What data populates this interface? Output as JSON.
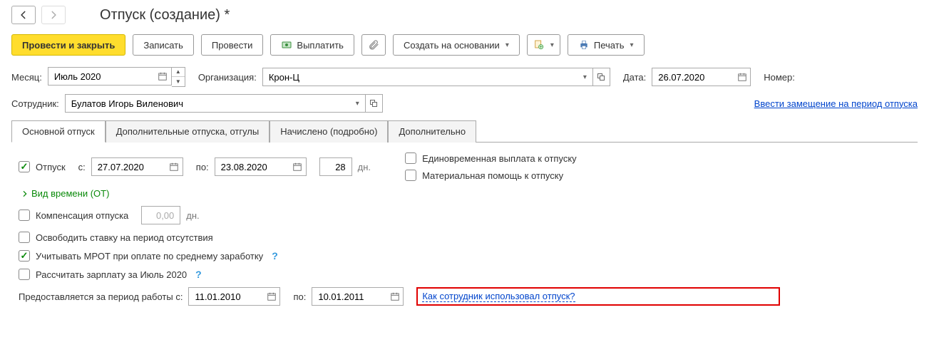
{
  "nav": {
    "back": "←",
    "forward": "→"
  },
  "title": "Отпуск (создание) *",
  "toolbar": {
    "post_close": "Провести и закрыть",
    "save": "Записать",
    "post": "Провести",
    "pay": "Выплатить",
    "create_based": "Создать на основании",
    "print": "Печать"
  },
  "row1": {
    "month_label": "Месяц:",
    "month_value": "Июль 2020",
    "org_label": "Организация:",
    "org_value": "Крон-Ц",
    "date_label": "Дата:",
    "date_value": "26.07.2020",
    "number_label": "Номер:"
  },
  "row2": {
    "emp_label": "Сотрудник:",
    "emp_value": "Булатов Игорь Виленович",
    "subst_link": "Ввести замещение на период отпуска"
  },
  "tabs": {
    "t1": "Основной отпуск",
    "t2": "Дополнительные отпуска, отгулы",
    "t3": "Начислено (подробно)",
    "t4": "Дополнительно"
  },
  "main": {
    "vac_label": "Отпуск",
    "from_label": "с:",
    "from_value": "27.07.2020",
    "to_label": "по:",
    "to_value": "23.08.2020",
    "days_value": "28",
    "days_unit": "дн.",
    "onetime_pay": "Единовременная выплата к отпуску",
    "mat_help": "Материальная помощь к отпуску",
    "time_type": "Вид времени (ОТ)",
    "comp_label": "Компенсация отпуска",
    "comp_value": "0,00",
    "comp_unit": "дн.",
    "free_rate": "Освободить ставку на период отсутствия",
    "use_mrot": "Учитывать МРОТ при оплате по среднему заработку",
    "calc_salary": "Рассчитать зарплату за Июль 2020",
    "period_label": "Предоставляется за период работы с:",
    "period_from": "11.01.2010",
    "period_to_label": "по:",
    "period_to": "10.01.2011",
    "usage_link": "Как сотрудник использовал отпуск?"
  }
}
